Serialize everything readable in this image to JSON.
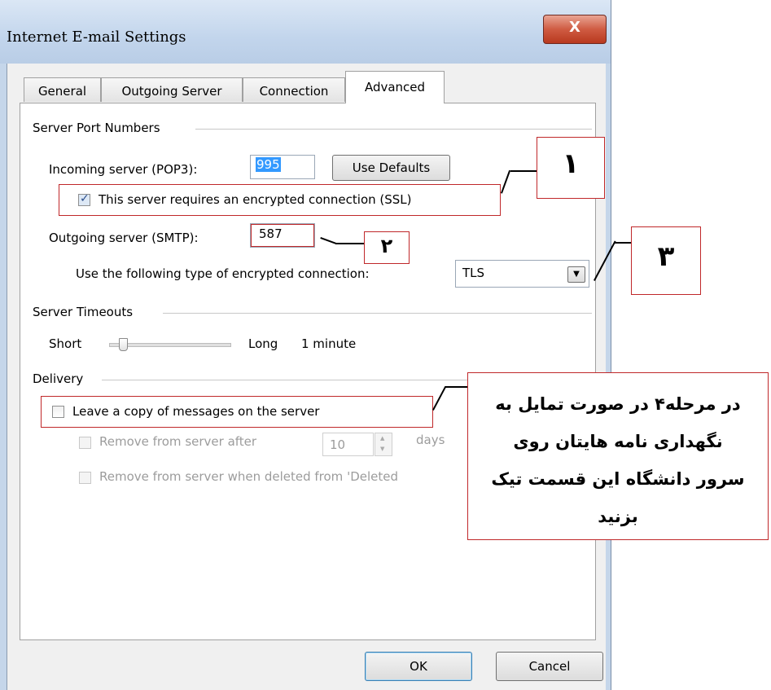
{
  "window": {
    "title": "Internet E-mail Settings",
    "close_glyph": "X"
  },
  "tabs": [
    {
      "label": "General"
    },
    {
      "label": "Outgoing Server"
    },
    {
      "label": "Connection"
    },
    {
      "label": "Advanced",
      "active": true
    }
  ],
  "ports": {
    "group_label": "Server Port Numbers",
    "incoming_label": "Incoming server (POP3):",
    "incoming_value": "995",
    "use_defaults_label": "Use Defaults",
    "ssl_label": "This server requires an encrypted connection (SSL)",
    "ssl_checked": true,
    "outgoing_label": "Outgoing server (SMTP):",
    "outgoing_value": "587",
    "encryption_label": "Use the following type of encrypted connection:",
    "encryption_value": "TLS"
  },
  "timeouts": {
    "group_label": "Server Timeouts",
    "short_label": "Short",
    "long_label": "Long",
    "value_label": "1 minute",
    "slider_position": 0.1
  },
  "delivery": {
    "group_label": "Delivery",
    "leave_copy_label": "Leave a copy of messages on the server",
    "leave_copy_checked": false,
    "remove_after_label": "Remove from server after",
    "remove_after_value": "10",
    "days_label": "days",
    "remove_deleted_label": "Remove from server when deleted from 'Deleted"
  },
  "buttons": {
    "ok_label": "OK",
    "cancel_label": "Cancel"
  },
  "annotations": {
    "callout_1": "۱",
    "callout_2": "۲",
    "callout_3": "۳",
    "callout_4_lines": [
      "در مرحله۴ در صورت تمایل به",
      "نگهداری نامه هایتان روی",
      "سرور دانشگاه این قسمت تیک",
      "بزنید"
    ],
    "accent_color": "#c0282a"
  }
}
